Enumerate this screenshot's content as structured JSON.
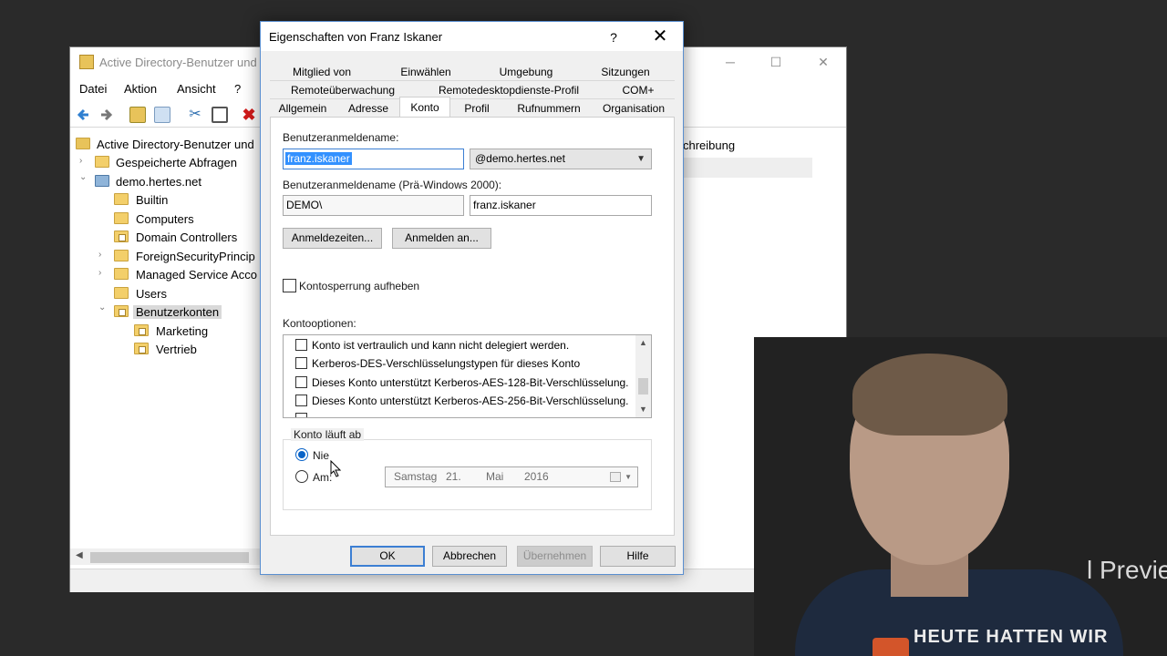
{
  "aduc": {
    "title": "Active Directory-Benutzer und",
    "menu": [
      "Datei",
      "Aktion",
      "Ansicht",
      "?"
    ],
    "tree": [
      {
        "label": "Active Directory-Benutzer und",
        "icon": "aduc-root-icon",
        "arrow": ""
      },
      {
        "label": "Gespeicherte Abfragen",
        "icon": "folder-icon",
        "arrow": "›"
      },
      {
        "label": "demo.hertes.net",
        "icon": "domain-icon",
        "arrow": "⌄"
      },
      {
        "label": "Builtin",
        "icon": "folder-icon",
        "arrow": ""
      },
      {
        "label": "Computers",
        "icon": "folder-icon",
        "arrow": ""
      },
      {
        "label": "Domain Controllers",
        "icon": "ou-icon",
        "arrow": ""
      },
      {
        "label": "ForeignSecurityPrincip",
        "icon": "folder-icon",
        "arrow": "›"
      },
      {
        "label": "Managed Service Acco",
        "icon": "folder-icon",
        "arrow": "›"
      },
      {
        "label": "Users",
        "icon": "folder-icon",
        "arrow": ""
      },
      {
        "label": "Benutzerkonten",
        "icon": "ou-icon",
        "arrow": "⌄",
        "selected": true
      },
      {
        "label": "Marketing",
        "icon": "ou-icon",
        "arrow": ""
      },
      {
        "label": "Vertrieb",
        "icon": "ou-icon",
        "arrow": ""
      }
    ],
    "column_header": "chreibung"
  },
  "dialog": {
    "title": "Eigenschaften von Franz Iskaner",
    "help": "?",
    "close": "✕",
    "tabs_row1": [
      "Mitglied von",
      "Einwählen",
      "Umgebung",
      "Sitzungen"
    ],
    "tabs_row2": [
      "Remoteüberwachung",
      "Remotedesktopdienste-Profil",
      "COM+"
    ],
    "tabs_row3": [
      "Allgemein",
      "Adresse",
      "Konto",
      "Profil",
      "Rufnummern",
      "Organisation"
    ],
    "active_tab": "Konto",
    "logon_name_label": "Benutzeranmeldename:",
    "logon_name_value": "franz.iskaner",
    "domain_suffix": "@demo.hertes.net",
    "pre2000_label": "Benutzeranmeldename (Prä-Windows 2000):",
    "pre2000_domain": "DEMO\\",
    "pre2000_user": "franz.iskaner",
    "logon_hours_button": "Anmeldezeiten...",
    "logon_to_button": "Anmelden an...",
    "unlock_label": "Kontosperrung aufheben",
    "unlock_checked": false,
    "options_label": "Kontooptionen:",
    "options": [
      {
        "label": "Konto ist vertraulich und kann nicht delegiert werden.",
        "checked": false
      },
      {
        "label": "Kerberos-DES-Verschlüsselungstypen für dieses Konto",
        "checked": false
      },
      {
        "label": "Dieses Konto unterstützt Kerberos-AES-128-Bit-Verschlüsselung.",
        "checked": false
      },
      {
        "label": "Dieses Konto unterstützt Kerberos-AES-256-Bit-Verschlüsselung.",
        "checked": false
      }
    ],
    "expires_group": "Konto läuft ab",
    "never_label": "Nie",
    "never_selected": true,
    "on_label": "Am:",
    "date": {
      "weekday": "Samstag",
      "day": "21.",
      "month": "Mai",
      "year": "2016"
    },
    "ok": "OK",
    "cancel": "Abbrechen",
    "apply": "Übernehmen",
    "helpbtn": "Hilfe"
  },
  "webcam": {
    "watermark": "l Preview",
    "shirt_text": "HEUTE HATTEN WIR"
  },
  "colors": {
    "accent": "#3c7fd3",
    "selection": "#3391ff",
    "folder": "#f3cf6a",
    "background": "#2a2a2a"
  }
}
